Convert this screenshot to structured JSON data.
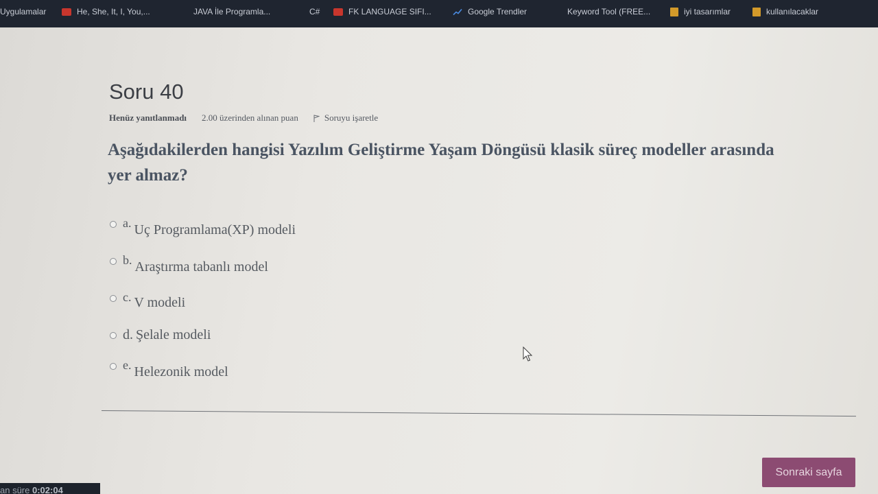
{
  "bookmarks": [
    {
      "label": "Uygulamalar",
      "icon": "apps-icon"
    },
    {
      "label": "He, She, It, I, You,...",
      "icon": "youtube-icon"
    },
    {
      "label": "JAVA İle Programla...",
      "icon": "page-icon"
    },
    {
      "label": "C#",
      "icon": "page-icon"
    },
    {
      "label": "FK LANGUAGE SIFI...",
      "icon": "youtube-icon"
    },
    {
      "label": "Google Trendler",
      "icon": "trends-icon"
    },
    {
      "label": "Keyword Tool (FREE...",
      "icon": "page-icon"
    },
    {
      "label": "iyi tasarımlar",
      "icon": "folder-icon"
    },
    {
      "label": "kullanılacaklar",
      "icon": "folder-icon"
    }
  ],
  "question": {
    "title": "Soru 40",
    "status": "Henüz yanıtlanmadı",
    "points": "2.00 üzerinden alınan puan",
    "flag_label": "Soruyu işaretle",
    "text": "Aşağıdakilerden hangisi Yazılım Geliştirme Yaşam Döngüsü klasik süreç modeller arasında yer almaz?"
  },
  "answers": [
    {
      "letter": "a.",
      "text": "Uç Programlama(XP) modeli"
    },
    {
      "letter": "b.",
      "text": "Araştırma tabanlı model"
    },
    {
      "letter": "c.",
      "text": "V modeli"
    },
    {
      "letter": "d.",
      "text": "Şelale modeli"
    },
    {
      "letter": "e.",
      "text": "Helezonik model"
    }
  ],
  "next_button": "Sonraki sayfa",
  "timer": {
    "label": "an süre",
    "value": "0:02:04"
  },
  "colors": {
    "accent": "#8c4b72",
    "bookmarks_bar": "#1f2530",
    "question_text": "#4a5462"
  }
}
